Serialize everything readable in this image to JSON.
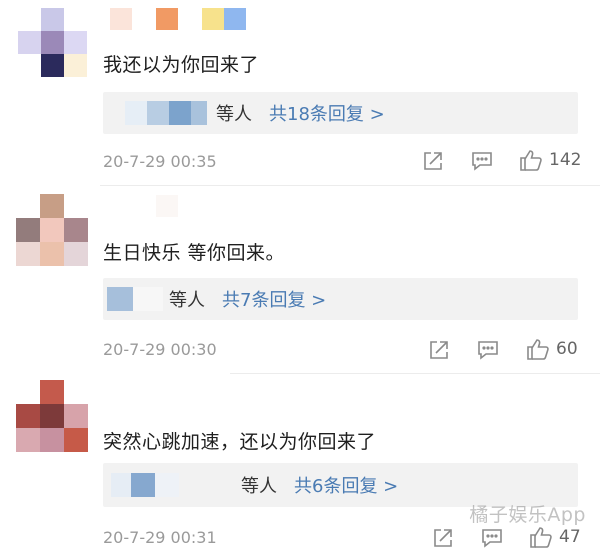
{
  "comments": [
    {
      "text": "我还以为你回来了",
      "reply_who": "等人",
      "reply_link": "共18条回复 >",
      "time": "20-7-29 00:35",
      "likes": "142"
    },
    {
      "text": "生日快乐 等你回来。",
      "reply_who": "等人",
      "reply_link": "共7条回复 >",
      "time": "20-7-29 00:30",
      "likes": "60"
    },
    {
      "text": "突然心跳加速，还以为你回来了",
      "reply_who": "等人",
      "reply_link": "共6条回复 >",
      "time": "20-7-29 00:31",
      "likes": "47"
    }
  ],
  "watermark": "橘子娱乐App",
  "icons": {
    "share": "share-icon",
    "comment": "comment-icon",
    "like": "thumbs-up-icon"
  },
  "colors": {
    "link": "#4a7bb3",
    "meta": "#9a9a9a",
    "reply_bg": "#f2f2f2"
  }
}
